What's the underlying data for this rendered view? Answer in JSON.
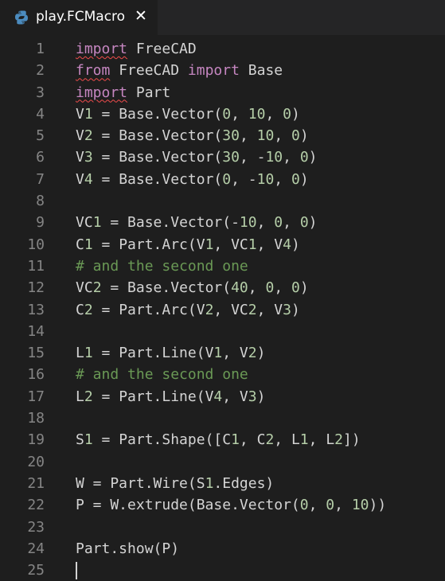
{
  "tab": {
    "icon": "python-file-icon",
    "label": "play.FCMacro",
    "close": "✕"
  },
  "editor": {
    "language": "python",
    "lines": [
      {
        "n": "1",
        "tokens": [
          {
            "t": "import",
            "c": "kw-err"
          },
          {
            "t": " FreeCAD",
            "c": "plain"
          }
        ]
      },
      {
        "n": "2",
        "tokens": [
          {
            "t": "from",
            "c": "kw-err"
          },
          {
            "t": " FreeCAD ",
            "c": "plain"
          },
          {
            "t": "import",
            "c": "kw"
          },
          {
            "t": " Base",
            "c": "plain"
          }
        ]
      },
      {
        "n": "3",
        "tokens": [
          {
            "t": "import",
            "c": "kw-err"
          },
          {
            "t": " Part",
            "c": "plain"
          }
        ]
      },
      {
        "n": "4",
        "tokens": [
          {
            "t": "V1 = Base.Vector(0, 10, 0)",
            "c": "plain"
          }
        ]
      },
      {
        "n": "5",
        "tokens": [
          {
            "t": "V2 = Base.Vector(30, 10, 0)",
            "c": "plain"
          }
        ]
      },
      {
        "n": "6",
        "tokens": [
          {
            "t": "V3 = Base.Vector(30, -10, 0)",
            "c": "plain"
          }
        ]
      },
      {
        "n": "7",
        "tokens": [
          {
            "t": "V4 = Base.Vector(0, -10, 0)",
            "c": "plain"
          }
        ]
      },
      {
        "n": "8",
        "tokens": []
      },
      {
        "n": "9",
        "tokens": [
          {
            "t": "VC1 = Base.Vector(-10, 0, 0)",
            "c": "plain"
          }
        ]
      },
      {
        "n": "10",
        "tokens": [
          {
            "t": "C1 = Part.Arc(V1, VC1, V4)",
            "c": "plain"
          }
        ]
      },
      {
        "n": "11",
        "tokens": [
          {
            "t": "# and the second one",
            "c": "cm"
          }
        ]
      },
      {
        "n": "12",
        "tokens": [
          {
            "t": "VC2 = Base.Vector(40, 0, 0)",
            "c": "plain"
          }
        ]
      },
      {
        "n": "13",
        "tokens": [
          {
            "t": "C2 = Part.Arc(V2, VC2, V3)",
            "c": "plain"
          }
        ]
      },
      {
        "n": "14",
        "tokens": []
      },
      {
        "n": "15",
        "tokens": [
          {
            "t": "L1 = Part.Line(V1, V2)",
            "c": "plain"
          }
        ]
      },
      {
        "n": "16",
        "tokens": [
          {
            "t": "# and the second one",
            "c": "cm"
          }
        ]
      },
      {
        "n": "17",
        "tokens": [
          {
            "t": "L2 = Part.Line(V4, V3)",
            "c": "plain"
          }
        ]
      },
      {
        "n": "18",
        "tokens": []
      },
      {
        "n": "19",
        "tokens": [
          {
            "t": "S1 = Part.Shape([C1, C2, L1, L2])",
            "c": "plain"
          }
        ]
      },
      {
        "n": "20",
        "tokens": []
      },
      {
        "n": "21",
        "tokens": [
          {
            "t": "W = Part.Wire(S1.Edges)",
            "c": "plain"
          }
        ]
      },
      {
        "n": "22",
        "tokens": [
          {
            "t": "P = W.extrude(Base.Vector(0, 0, 10))",
            "c": "plain"
          }
        ]
      },
      {
        "n": "23",
        "tokens": []
      },
      {
        "n": "24",
        "tokens": [
          {
            "t": "Part.show(P)",
            "c": "plain"
          }
        ]
      },
      {
        "n": "25",
        "tokens": [],
        "cursor": true
      }
    ]
  },
  "colors": {
    "background": "#1e1e1e",
    "tabbar": "#252526",
    "keyword": "#c586c0",
    "comment": "#6a9955",
    "number": "#b5cea8",
    "text": "#d4d4d4",
    "line_number": "#858585",
    "error_squiggle": "#f14c4c"
  }
}
